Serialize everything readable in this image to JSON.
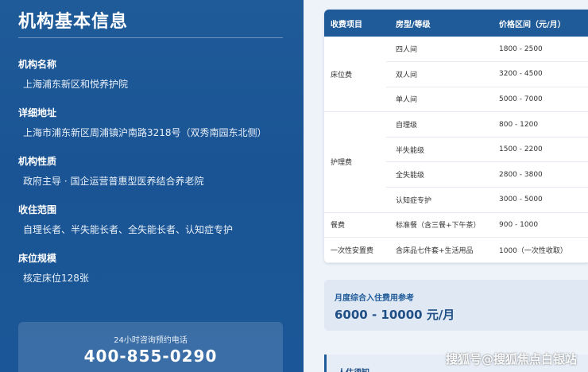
{
  "left": {
    "title": "机构基本信息",
    "fields": [
      {
        "label": "机构名称",
        "value": "上海浦东新区和悦养护院"
      },
      {
        "label": "详细地址",
        "value": "上海市浦东新区周浦镇沪南路3218号（双秀南园东北侧）"
      },
      {
        "label": "机构性质",
        "value": "政府主导 · 国企运营普惠型医养结合养老院"
      },
      {
        "label": "收住范围",
        "value": "自理长者、半失能长者、全失能长者、认知症专护"
      },
      {
        "label": "床位规模",
        "value": "核定床位128张"
      }
    ],
    "phone_hint": "24小时咨询预约电话",
    "phone_number": "400-855-0290"
  },
  "table": {
    "headers": [
      "收费项目",
      "房型/等级",
      "价格区间（元/月）"
    ],
    "groups": [
      {
        "category": "床位费",
        "rows": [
          {
            "type": "四人间",
            "price": "1800 - 2500"
          },
          {
            "type": "双人间",
            "price": "3200 - 4500"
          },
          {
            "type": "单人间",
            "price": "5000 - 7000"
          }
        ]
      },
      {
        "category": "护理费",
        "rows": [
          {
            "type": "自理级",
            "price": "800 - 1200"
          },
          {
            "type": "半失能级",
            "price": "1500 - 2200"
          },
          {
            "type": "全失能级",
            "price": "2800 - 3800"
          },
          {
            "type": "认知症专护",
            "price": "3000 - 5000"
          }
        ]
      },
      {
        "category": "餐费",
        "rows": [
          {
            "type": "标准餐（含三餐+下午茶）",
            "price": "900 - 1000"
          }
        ]
      },
      {
        "category": "一次性安置费",
        "rows": [
          {
            "type": "含床品七件套+生活用品",
            "price": "1000（一次性收取）"
          }
        ]
      }
    ]
  },
  "monthly": {
    "label": "月度综合入住费用参考",
    "value": "6000 - 10000 元/月"
  },
  "bottom_card": {
    "partial_text": "人住须知"
  },
  "watermark": "搜狐号@搜狐焦点白银站"
}
